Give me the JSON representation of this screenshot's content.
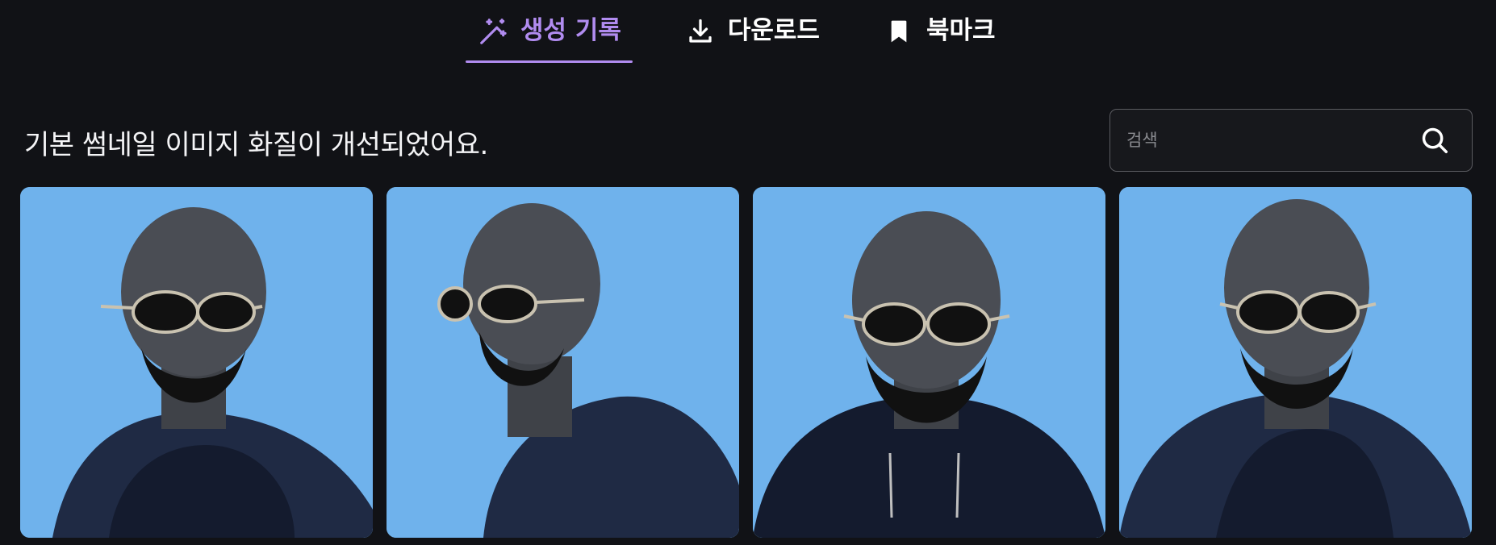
{
  "tabs": [
    {
      "label": "생성 기록",
      "icon": "magic-wand-icon",
      "active": true
    },
    {
      "label": "다운로드",
      "icon": "download-icon",
      "active": false
    },
    {
      "label": "북마크",
      "icon": "bookmark-icon",
      "active": false
    }
  ],
  "notice": "기본 썸네일 이미지 화질이 개선되었어요.",
  "search": {
    "placeholder": "검색",
    "value": "",
    "icon": "search-icon"
  },
  "gallery": {
    "items": [
      {
        "pose": "three-quarter-left"
      },
      {
        "pose": "profile-left"
      },
      {
        "pose": "front"
      },
      {
        "pose": "front-slight-right"
      }
    ]
  },
  "colors": {
    "background": "#111216",
    "accent": "#b18cf0",
    "card_bg": "#6fb2ec",
    "hoodie": "#1f2a44",
    "skin": "#4a4d54"
  }
}
